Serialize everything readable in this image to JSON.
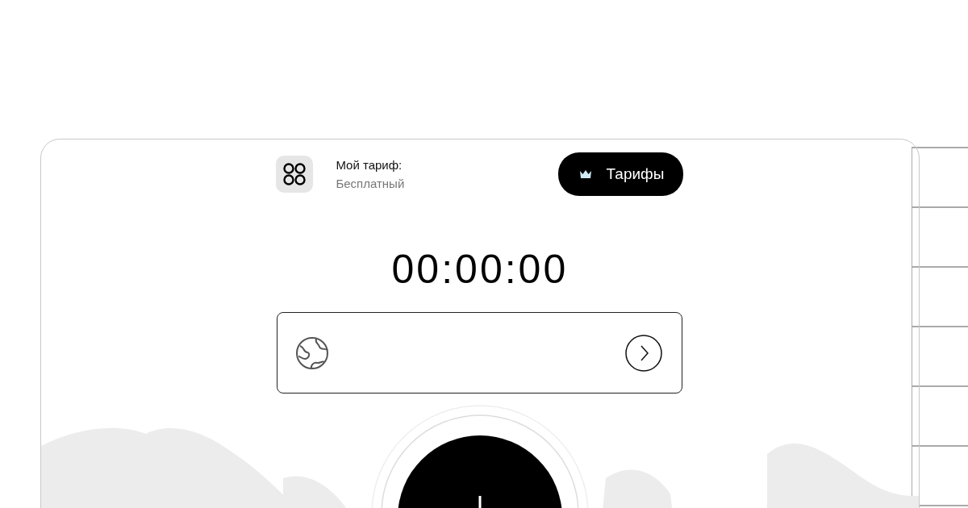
{
  "plan": {
    "label": "Мой тариф:",
    "value": "Бесплатный"
  },
  "tariffs_button": {
    "label": "Тарифы"
  },
  "timer": "00:00:00"
}
